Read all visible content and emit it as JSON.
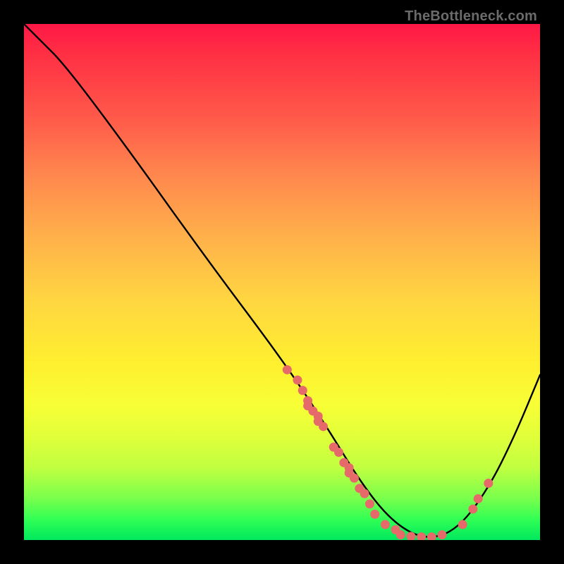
{
  "watermark": "TheBottleneck.com",
  "chart_data": {
    "type": "line",
    "title": "",
    "xlabel": "",
    "ylabel": "",
    "xlim": [
      0,
      100
    ],
    "ylim": [
      0,
      100
    ],
    "curve": [
      {
        "x": 0,
        "y": 100
      },
      {
        "x": 3,
        "y": 97
      },
      {
        "x": 8,
        "y": 92
      },
      {
        "x": 20,
        "y": 76
      },
      {
        "x": 35,
        "y": 55
      },
      {
        "x": 50,
        "y": 35
      },
      {
        "x": 58,
        "y": 23
      },
      {
        "x": 66,
        "y": 10
      },
      {
        "x": 72,
        "y": 3
      },
      {
        "x": 78,
        "y": 0
      },
      {
        "x": 84,
        "y": 2
      },
      {
        "x": 90,
        "y": 10
      },
      {
        "x": 95,
        "y": 20
      },
      {
        "x": 100,
        "y": 32
      }
    ],
    "points": [
      {
        "x": 51,
        "y": 33
      },
      {
        "x": 53,
        "y": 31
      },
      {
        "x": 54,
        "y": 29
      },
      {
        "x": 55,
        "y": 27
      },
      {
        "x": 55,
        "y": 26
      },
      {
        "x": 56,
        "y": 25
      },
      {
        "x": 57,
        "y": 24
      },
      {
        "x": 57,
        "y": 23
      },
      {
        "x": 58,
        "y": 22
      },
      {
        "x": 60,
        "y": 18
      },
      {
        "x": 61,
        "y": 17
      },
      {
        "x": 62,
        "y": 15
      },
      {
        "x": 63,
        "y": 14
      },
      {
        "x": 63,
        "y": 13
      },
      {
        "x": 64,
        "y": 12
      },
      {
        "x": 65,
        "y": 10
      },
      {
        "x": 66,
        "y": 9
      },
      {
        "x": 67,
        "y": 7
      },
      {
        "x": 68,
        "y": 5
      },
      {
        "x": 70,
        "y": 3
      },
      {
        "x": 72,
        "y": 2
      },
      {
        "x": 73,
        "y": 1
      },
      {
        "x": 75,
        "y": 0.7
      },
      {
        "x": 77,
        "y": 0.6
      },
      {
        "x": 79,
        "y": 0.6
      },
      {
        "x": 81,
        "y": 1
      },
      {
        "x": 85,
        "y": 3
      },
      {
        "x": 87,
        "y": 6
      },
      {
        "x": 88,
        "y": 8
      },
      {
        "x": 90,
        "y": 11
      }
    ],
    "point_color": "#e66a6a",
    "curve_color": "#000000"
  }
}
